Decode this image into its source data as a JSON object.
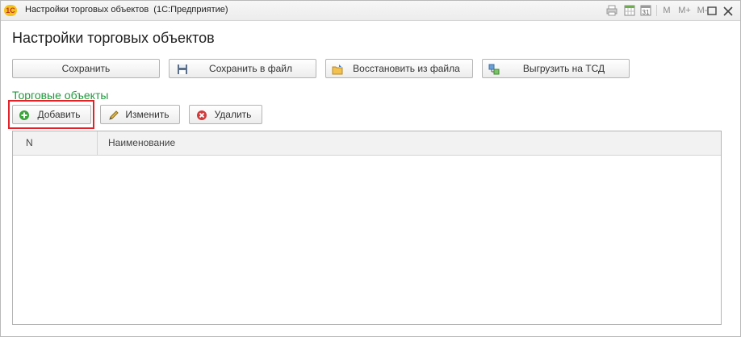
{
  "window": {
    "title": "Настройки торговых объектов  (1С:Предприятие)",
    "logo": "1С",
    "controls": [
      "print-icon",
      "calendar-grid-icon",
      "calendar-icon",
      "M",
      "M+",
      "M-",
      "restore-icon",
      "close-icon"
    ],
    "memory": {
      "m": "M",
      "m_plus": "M+",
      "m_minus": "M-"
    },
    "calendar_day": "31"
  },
  "form": {
    "title": "Настройки торговых объектов"
  },
  "toolbar": {
    "save": "Сохранить",
    "save_to_file": "Сохранить в файл",
    "restore_from_file": "Восстановить из файла",
    "export_tsd": "Выгрузить на ТСД"
  },
  "group": {
    "title": "Торговые объекты",
    "actions": {
      "add": "Добавить",
      "edit": "Изменить",
      "delete": "Удалить"
    },
    "table": {
      "columns": [
        "N",
        "Наименование"
      ],
      "rows": []
    }
  },
  "colors": {
    "group_title": "#1e9a3c",
    "highlight": "#e0232a"
  }
}
